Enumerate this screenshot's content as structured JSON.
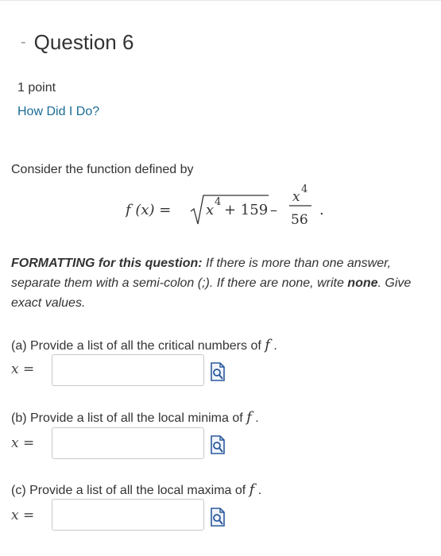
{
  "question": {
    "dash": "-",
    "title": "Question 6",
    "points": "1 point",
    "help_link": "How Did I Do?"
  },
  "prompt": {
    "intro": "Consider the function defined by",
    "equation": {
      "lhs": "f (x) =",
      "radicand_var": "x",
      "radicand_exp": "4",
      "radicand_rest": "+ 159",
      "minus": "–",
      "frac_num_var": "x",
      "frac_num_exp": "4",
      "frac_den": "56",
      "end": "."
    }
  },
  "formatting": {
    "label": "FORMATTING for this question:",
    "text1": " If there is more than one answer, separate them with a semi-colon (;). If there are none, write ",
    "none_word": "none",
    "text2": ". Give exact values."
  },
  "parts": [
    {
      "prompt": "(a) Provide a list of all the critical numbers of",
      "f": "f",
      "end": ".",
      "var_label": "x =",
      "value": ""
    },
    {
      "prompt": "(b) Provide a list of all the local minima of",
      "f": "f",
      "end": ".",
      "var_label": "x =",
      "value": ""
    },
    {
      "prompt": "(c) Provide a list of all the local maxima of",
      "f": "f",
      "end": ".",
      "var_label": "x =",
      "value": ""
    }
  ],
  "icons": {
    "formula_helper": "formula-preview-icon",
    "collapse": "dash"
  },
  "colors": {
    "link": "#1c6c96",
    "text": "#333333",
    "border": "#c8c8c8",
    "icon_blue": "#2b5a9e"
  }
}
